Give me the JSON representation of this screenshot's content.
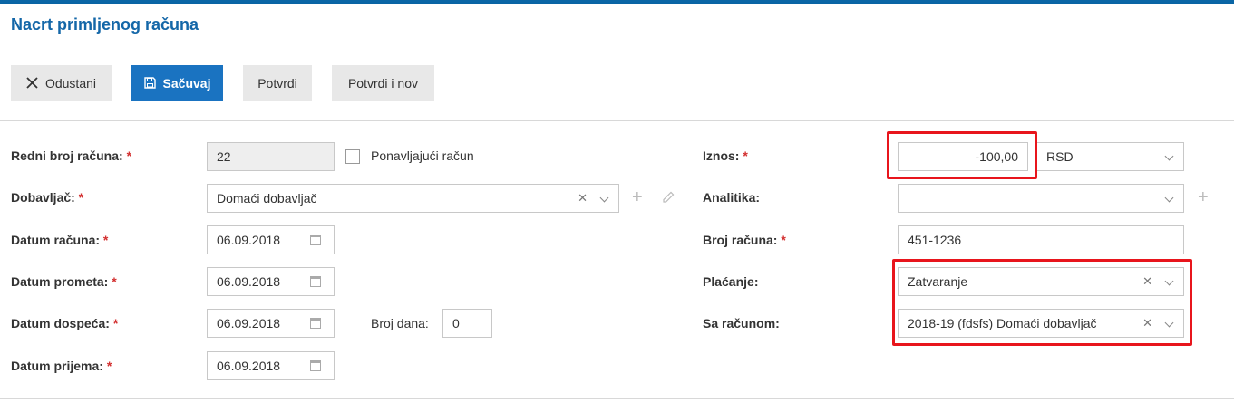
{
  "header": {
    "title": "Nacrt primljenog računa"
  },
  "toolbar": {
    "cancel_label": "Odustani",
    "save_label": "Sačuvaj",
    "confirm_label": "Potvrdi",
    "confirm_new_label": "Potvrdi i nov"
  },
  "form": {
    "required_mark": "*",
    "invoice_number": {
      "label": "Redni broj računa:",
      "value": "22"
    },
    "recurring": {
      "label": "Ponavljajući račun",
      "checked": false
    },
    "supplier": {
      "label": "Dobavljač:",
      "value": "Domaći dobavljač"
    },
    "invoice_date": {
      "label": "Datum računa:",
      "value": "06.09.2018"
    },
    "turnover_date": {
      "label": "Datum prometa:",
      "value": "06.09.2018"
    },
    "due_date": {
      "label": "Datum dospeća:",
      "value": "06.09.2018"
    },
    "days": {
      "label": "Broj dana:",
      "value": "0"
    },
    "receipt_date": {
      "label": "Datum prijema:",
      "value": "06.09.2018"
    },
    "amount": {
      "label": "Iznos:",
      "value": "-100,00"
    },
    "currency": {
      "value": "RSD"
    },
    "analytics": {
      "label": "Analitika:",
      "value": ""
    },
    "account_number": {
      "label": "Broj računa:",
      "value": "451-1236"
    },
    "payment": {
      "label": "Plaćanje:",
      "value": "Zatvaranje"
    },
    "with_invoice": {
      "label": "Sa računom:",
      "value": "2018-19 (fdsfs) Domaći dobavljač"
    }
  },
  "colors": {
    "accent": "#1a73c1",
    "title": "#1467a8",
    "required": "#d32f2f",
    "highlight": "#e8151c"
  }
}
